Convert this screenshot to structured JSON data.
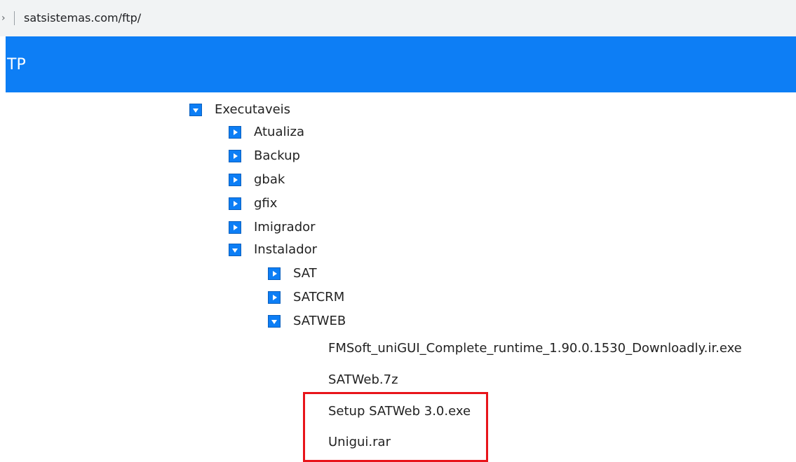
{
  "browser": {
    "url": "satsistemas.com/ftp/"
  },
  "header": {
    "title": "TP"
  },
  "tree": {
    "root": {
      "label": "Executaveis",
      "state": "expanded"
    },
    "folders": [
      {
        "label": "Atualiza",
        "state": "collapsed"
      },
      {
        "label": "Backup",
        "state": "collapsed"
      },
      {
        "label": "gbak",
        "state": "collapsed"
      },
      {
        "label": "gfix",
        "state": "collapsed"
      },
      {
        "label": "Imigrador",
        "state": "collapsed"
      },
      {
        "label": "Instalador",
        "state": "expanded"
      }
    ],
    "instalador_children": [
      {
        "label": "SAT",
        "state": "collapsed"
      },
      {
        "label": "SATCRM",
        "state": "collapsed"
      },
      {
        "label": "SATWEB",
        "state": "expanded"
      }
    ],
    "satweb_files": [
      "FMSoft_uniGUI_Complete_runtime_1.90.0.1530_Downloadly.ir.exe",
      "SATWeb.7z",
      "Setup SATWeb 3.0.exe",
      "Unigui.rar"
    ]
  },
  "colors": {
    "accent": "#0d7ef5",
    "highlight": "#e8141a"
  }
}
